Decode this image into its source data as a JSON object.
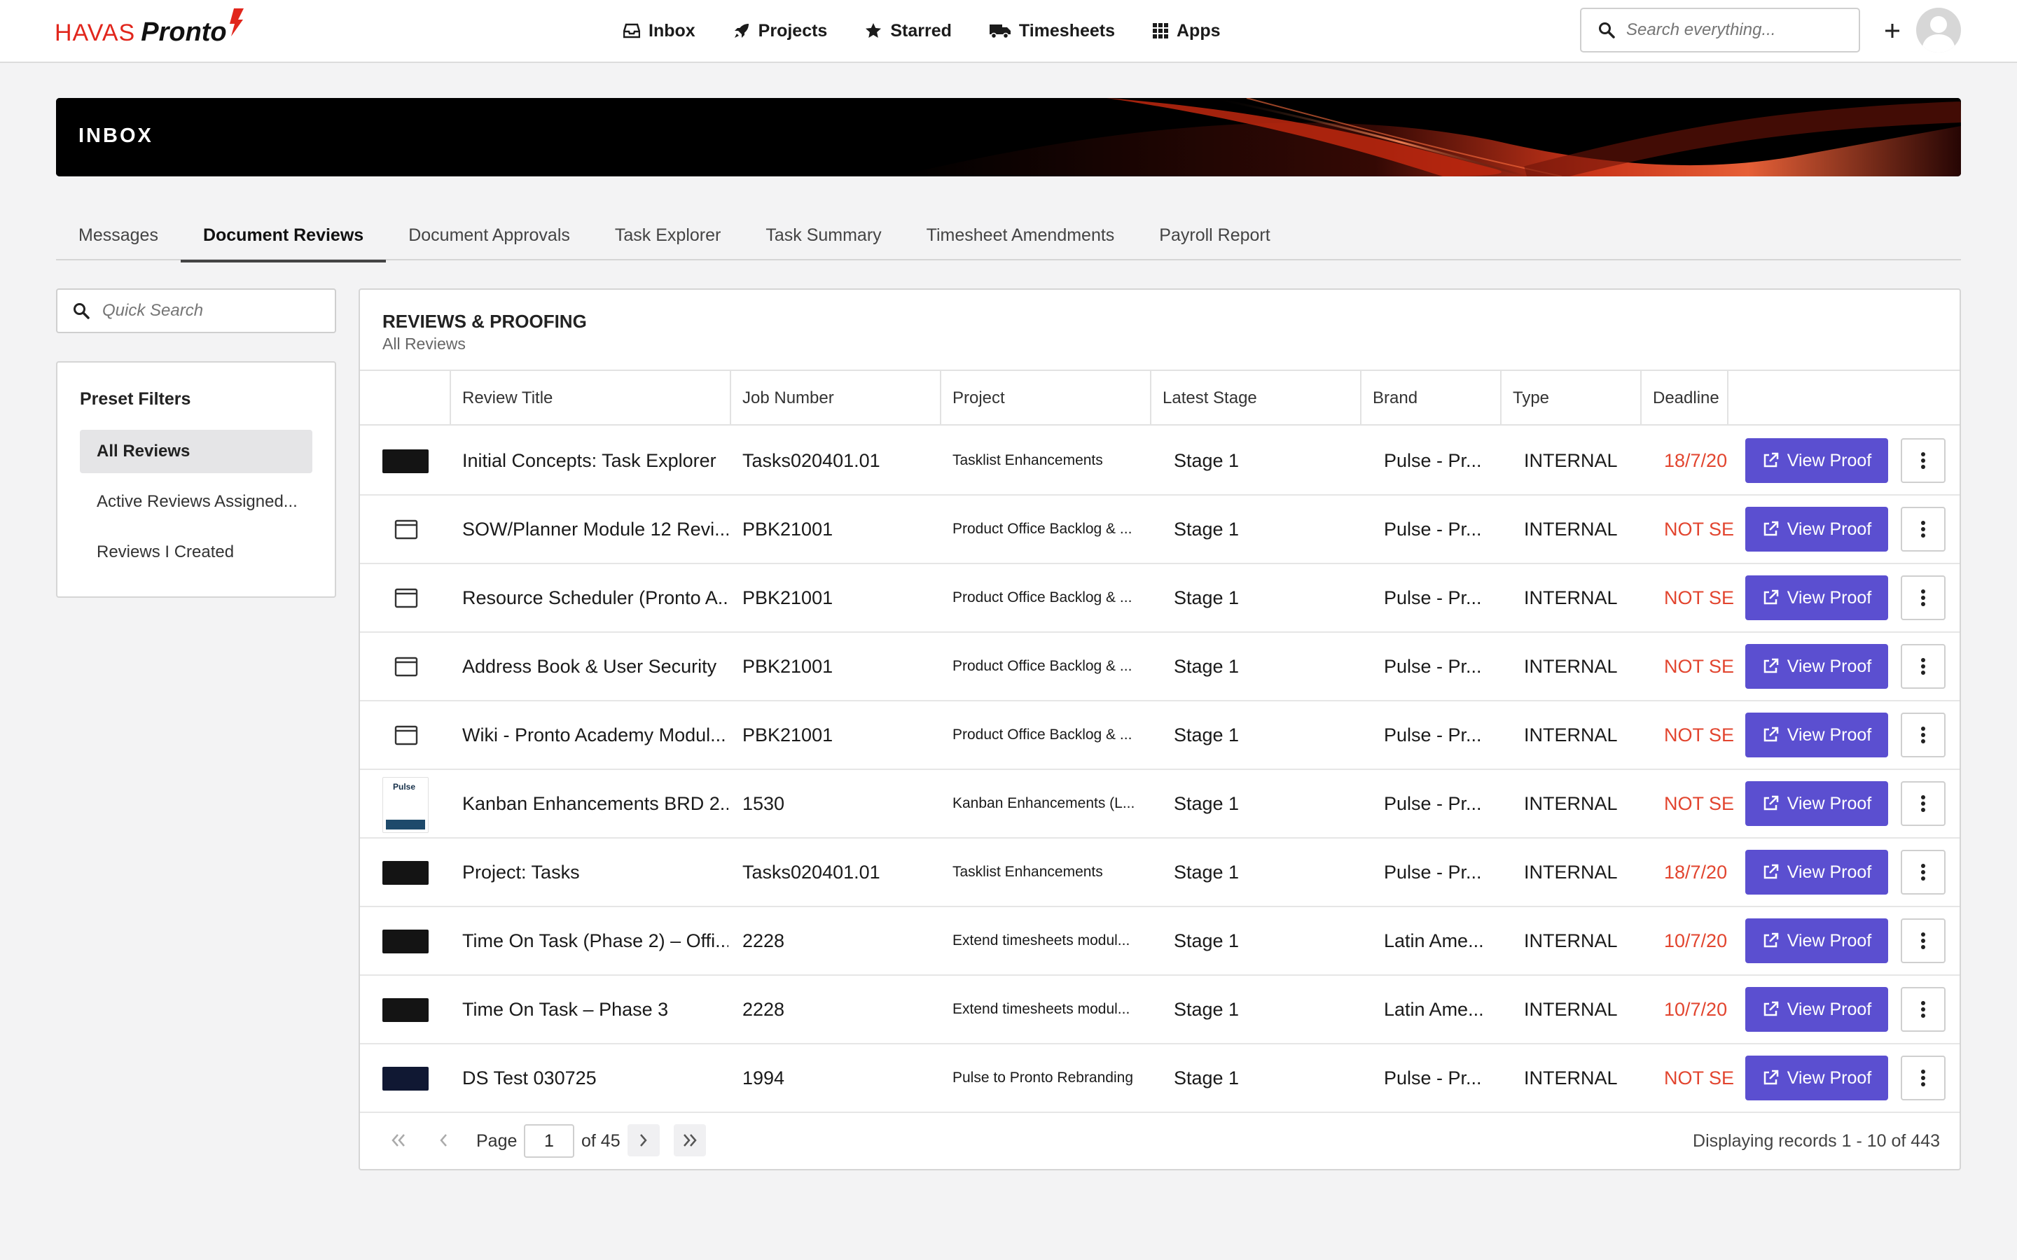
{
  "logo": {
    "brand": "HAVAS",
    "product": "Pronto"
  },
  "nav": [
    {
      "label": "Inbox",
      "icon": "inbox-icon"
    },
    {
      "label": "Projects",
      "icon": "rocket-icon"
    },
    {
      "label": "Starred",
      "icon": "star-icon"
    },
    {
      "label": "Timesheets",
      "icon": "truck-icon"
    },
    {
      "label": "Apps",
      "icon": "grid-icon"
    }
  ],
  "search": {
    "placeholder": "Search everything..."
  },
  "banner": {
    "title": "INBOX"
  },
  "tabs": [
    {
      "label": "Messages",
      "active": false
    },
    {
      "label": "Document Reviews",
      "active": true
    },
    {
      "label": "Document Approvals",
      "active": false
    },
    {
      "label": "Task Explorer",
      "active": false
    },
    {
      "label": "Task Summary",
      "active": false
    },
    {
      "label": "Timesheet Amendments",
      "active": false
    },
    {
      "label": "Payroll Report",
      "active": false
    }
  ],
  "quick_search": {
    "placeholder": "Quick Search"
  },
  "presets": {
    "title": "Preset Filters",
    "items": [
      {
        "label": "All Reviews",
        "active": true
      },
      {
        "label": "Active Reviews Assigned...",
        "active": false
      },
      {
        "label": "Reviews I Created",
        "active": false
      }
    ]
  },
  "panel": {
    "title": "REVIEWS & PROOFING",
    "subtitle": "All Reviews"
  },
  "columns": [
    "Review Title",
    "Job Number",
    "Project",
    "Latest Stage",
    "Brand",
    "Type",
    "Deadline"
  ],
  "view_label": "View Proof",
  "rows": [
    {
      "thumb": "dark",
      "title": "Initial Concepts: Task Explorer",
      "job": "Tasks020401.01",
      "project": "Tasklist Enhancements",
      "stage": "Stage 1",
      "brand": "Pulse - Pr...",
      "type": "INTERNAL",
      "deadline": "18/7/20"
    },
    {
      "thumb": "folder",
      "title": "SOW/Planner Module 12 Revi...",
      "job": "PBK21001",
      "project": "Product Office Backlog & ...",
      "stage": "Stage 1",
      "brand": "Pulse - Pr...",
      "type": "INTERNAL",
      "deadline": "NOT SE"
    },
    {
      "thumb": "folder",
      "title": "Resource Scheduler (Pronto A...",
      "job": "PBK21001",
      "project": "Product Office Backlog & ...",
      "stage": "Stage 1",
      "brand": "Pulse - Pr...",
      "type": "INTERNAL",
      "deadline": "NOT SE"
    },
    {
      "thumb": "folder",
      "title": "Address Book & User Security",
      "job": "PBK21001",
      "project": "Product Office Backlog & ...",
      "stage": "Stage 1",
      "brand": "Pulse - Pr...",
      "type": "INTERNAL",
      "deadline": "NOT SE"
    },
    {
      "thumb": "folder",
      "title": "Wiki - Pronto Academy Modul...",
      "job": "PBK21001",
      "project": "Product Office Backlog & ...",
      "stage": "Stage 1",
      "brand": "Pulse - Pr...",
      "type": "INTERNAL",
      "deadline": "NOT SE"
    },
    {
      "thumb": "doc",
      "thumb_text": "Pulse",
      "title": "Kanban Enhancements BRD 2...",
      "job": "1530",
      "project": "Kanban Enhancements (L...",
      "stage": "Stage 1",
      "brand": "Pulse - Pr...",
      "type": "INTERNAL",
      "deadline": "NOT SE"
    },
    {
      "thumb": "dark",
      "title": "Project: Tasks",
      "job": "Tasks020401.01",
      "project": "Tasklist Enhancements",
      "stage": "Stage 1",
      "brand": "Pulse - Pr...",
      "type": "INTERNAL",
      "deadline": "18/7/20"
    },
    {
      "thumb": "dark",
      "title": "Time On Task (Phase 2) – Offi...",
      "job": "2228",
      "project": "Extend timesheets modul...",
      "stage": "Stage 1",
      "brand": "Latin Ame...",
      "type": "INTERNAL",
      "deadline": "10/7/20"
    },
    {
      "thumb": "dark",
      "title": "Time On Task – Phase 3",
      "job": "2228",
      "project": "Extend timesheets modul...",
      "stage": "Stage 1",
      "brand": "Latin Ame...",
      "type": "INTERNAL",
      "deadline": "10/7/20"
    },
    {
      "thumb": "navy",
      "title": "DS Test 030725",
      "job": "1994",
      "project": "Pulse to Pronto Rebranding",
      "stage": "Stage 1",
      "brand": "Pulse - Pr...",
      "type": "INTERNAL",
      "deadline": "NOT SE"
    }
  ],
  "pager": {
    "page_label": "Page",
    "page": "1",
    "of_label": "of 45",
    "records": "Displaying records 1 - 10 of 443"
  },
  "colors": {
    "accent": "#5b4fd0",
    "deadline": "#e2452f",
    "brand_red": "#e1261c"
  }
}
